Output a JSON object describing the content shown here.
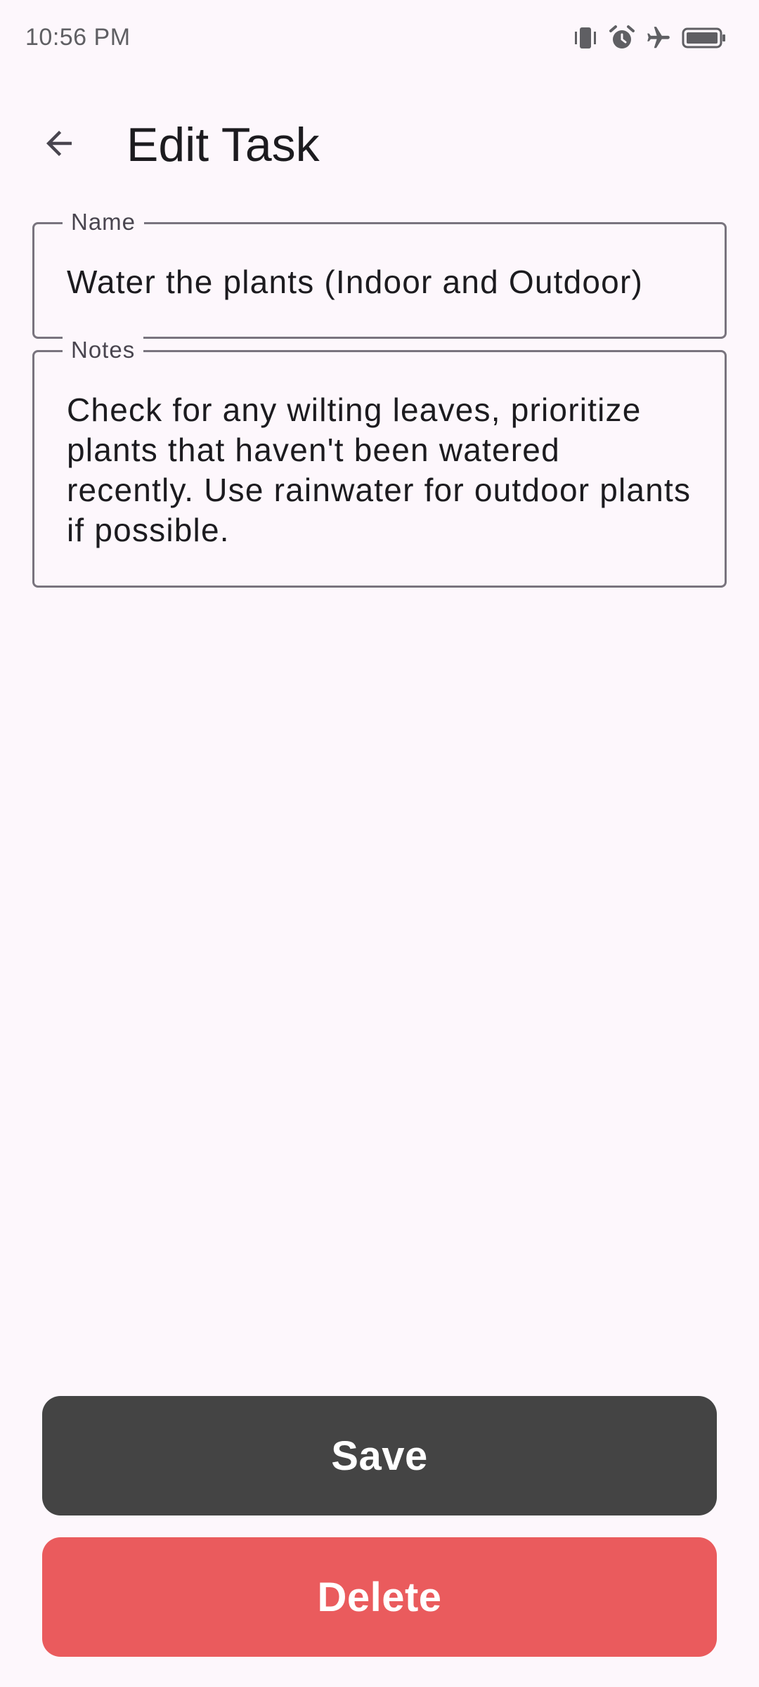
{
  "status_bar": {
    "time": "10:56 PM",
    "icons": [
      "vibrate-icon",
      "alarm-icon",
      "airplane-mode-icon",
      "battery-icon"
    ]
  },
  "app_bar": {
    "back_icon": "arrow-back-icon",
    "title": "Edit Task"
  },
  "form": {
    "name": {
      "label": "Name",
      "value": "Water the plants (Indoor and Outdoor)"
    },
    "notes": {
      "label": "Notes",
      "value": "Check for any wilting leaves, prioritize plants that haven't been watered recently. Use rainwater for outdoor plants if possible."
    }
  },
  "actions": {
    "save_label": "Save",
    "delete_label": "Delete"
  },
  "colors": {
    "background": "#fdf7fc",
    "save_button": "#444444",
    "delete_button": "#ea5b5d",
    "field_outline": "#79747e"
  }
}
